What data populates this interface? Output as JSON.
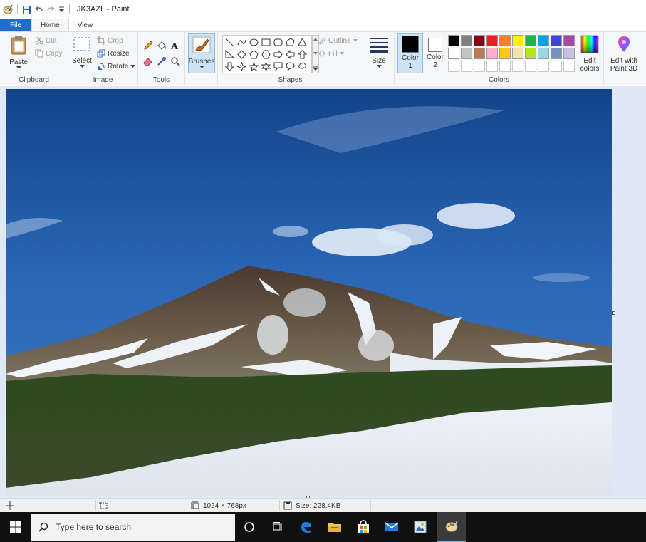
{
  "window": {
    "title": "JK3AZL - Paint"
  },
  "tabs": [
    {
      "label": "File"
    },
    {
      "label": "Home"
    },
    {
      "label": "View"
    }
  ],
  "ribbon": {
    "clipboard": {
      "label": "Clipboard",
      "paste": "Paste",
      "cut": "Cut",
      "copy": "Copy"
    },
    "image": {
      "label": "Image",
      "select": "Select",
      "crop": "Crop",
      "resize": "Resize",
      "rotate": "Rotate"
    },
    "tools": {
      "label": "Tools"
    },
    "brushes": {
      "label": "Brushes"
    },
    "shapes": {
      "label": "Shapes",
      "outline": "Outline",
      "fill": "Fill"
    },
    "size": {
      "label": "Size"
    },
    "colors": {
      "label": "Colors",
      "color1_line1": "Color",
      "color1_line2": "1",
      "color2_line1": "Color",
      "color2_line2": "2",
      "edit_line1": "Edit",
      "edit_line2": "colors",
      "paint3d_line1": "Edit with",
      "paint3d_line2": "Paint 3D",
      "color1_value": "#000000",
      "color2_value": "#ffffff",
      "palette_row1": [
        "#000000",
        "#7f7f7f",
        "#880015",
        "#ed1c24",
        "#ff7f27",
        "#fff200",
        "#22b14c",
        "#00a2e8",
        "#3f48cc",
        "#a349a4"
      ],
      "palette_row2": [
        "#ffffff",
        "#c3c3c3",
        "#b97a57",
        "#ffaec9",
        "#ffc90e",
        "#efe4b0",
        "#b5e61d",
        "#99d9ea",
        "#7092be",
        "#c8bfe7"
      ]
    }
  },
  "status": {
    "dimensions": "1024 × 768px",
    "size": "Size: 228.4KB"
  },
  "taskbar": {
    "search_placeholder": "Type here to search"
  }
}
